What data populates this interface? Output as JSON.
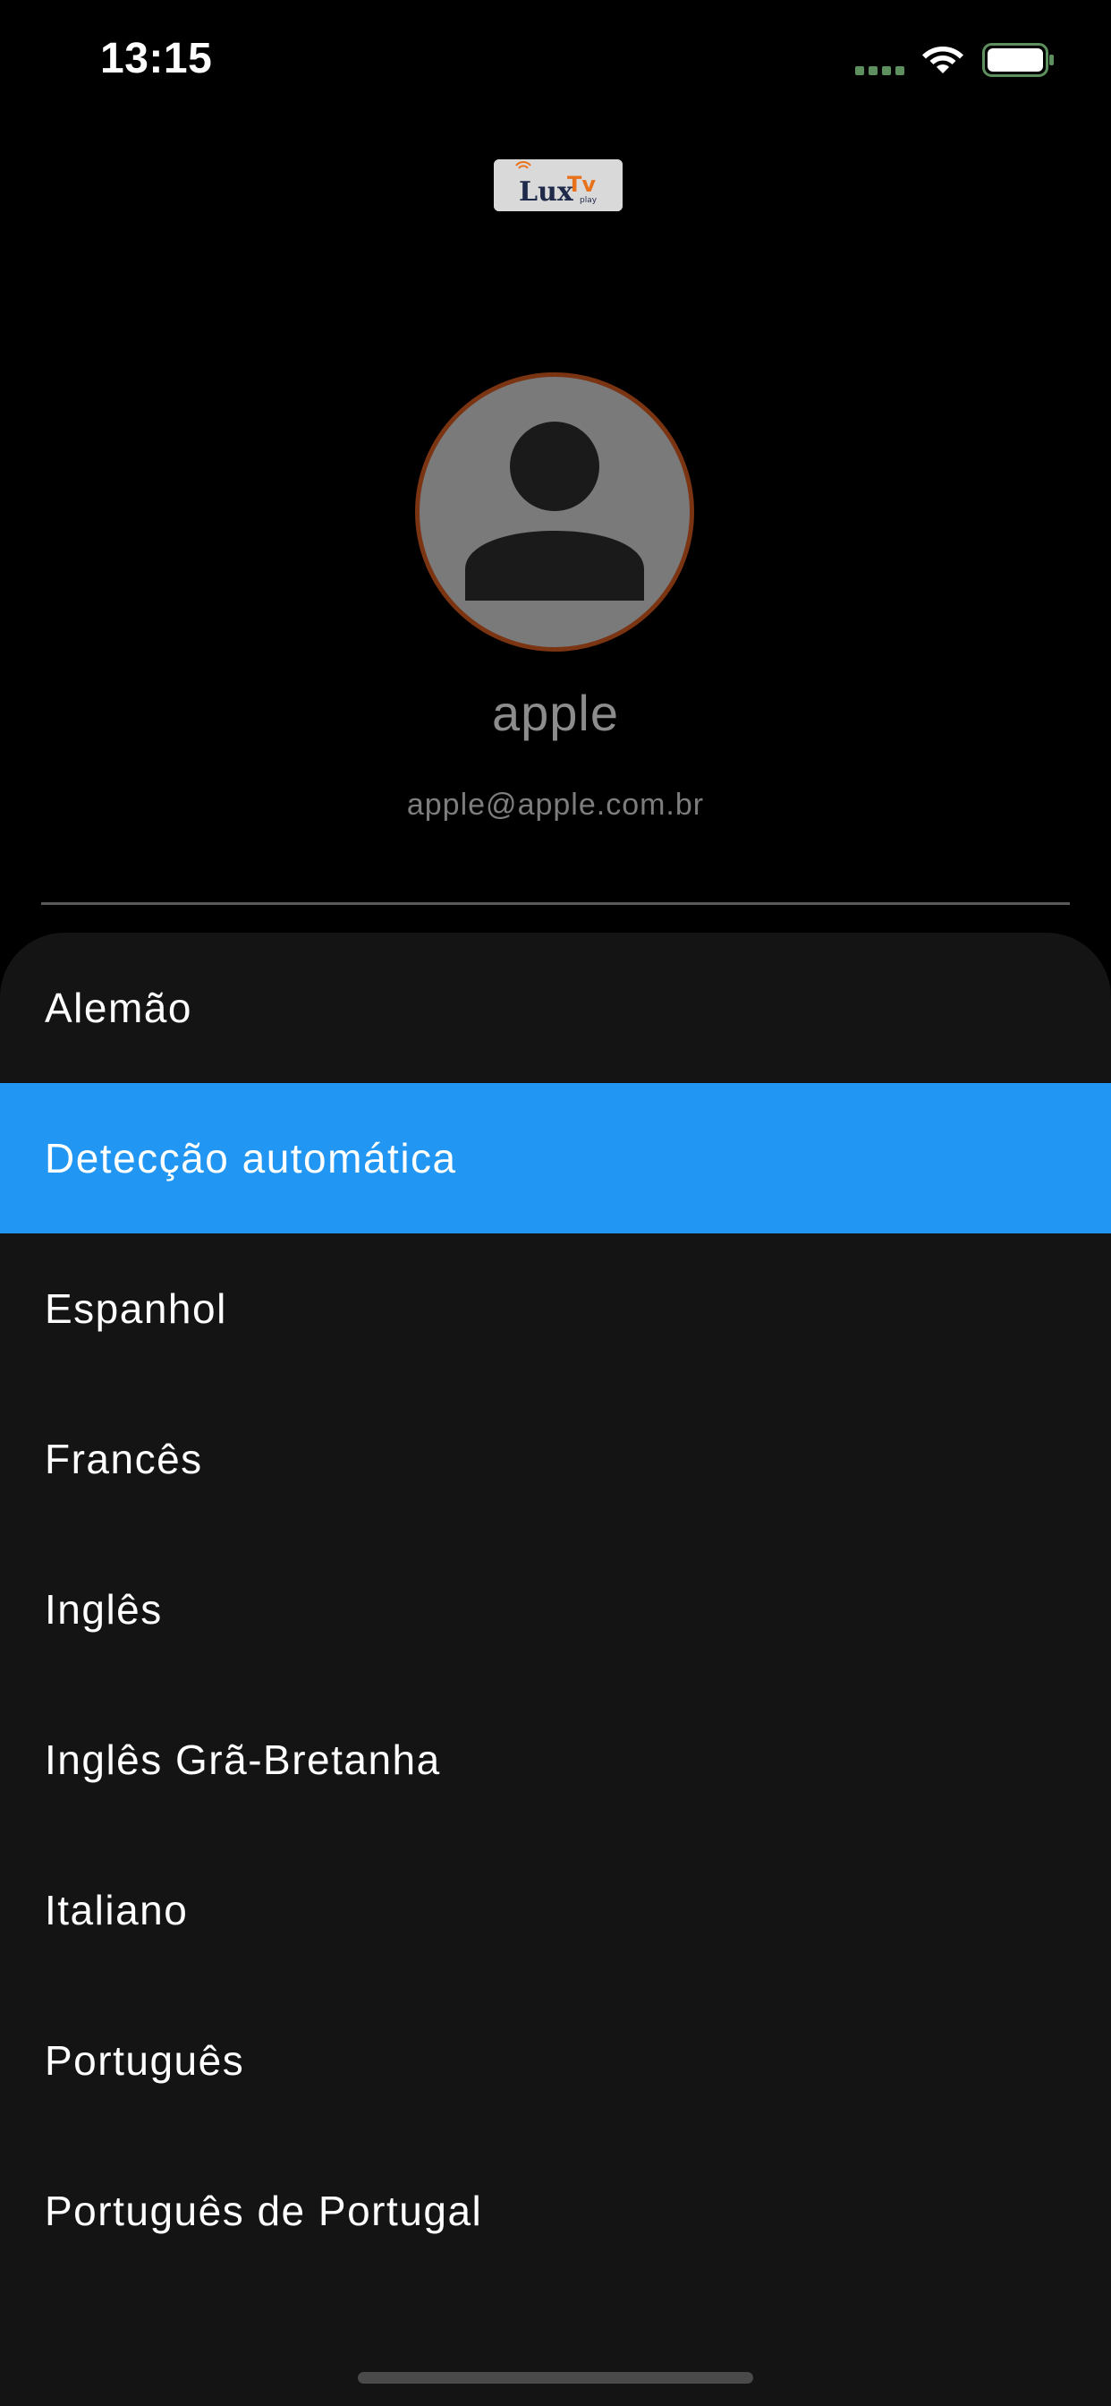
{
  "status_bar": {
    "time": "13:15",
    "signal_icon": "cellular-signal-icon",
    "wifi_icon": "wifi-icon",
    "battery_icon": "battery-full-icon"
  },
  "logo": {
    "text_lux": "Lux",
    "text_tv": "Tv",
    "text_play": "play"
  },
  "profile": {
    "avatar_icon": "person-icon",
    "name": "apple",
    "email": "apple@apple.com.br"
  },
  "languages": {
    "items": [
      {
        "label": "Alemão",
        "selected": false
      },
      {
        "label": "Detecção automática",
        "selected": true
      },
      {
        "label": "Espanhol",
        "selected": false
      },
      {
        "label": "Francês",
        "selected": false
      },
      {
        "label": "Inglês",
        "selected": false
      },
      {
        "label": "Inglês Grã-Bretanha",
        "selected": false
      },
      {
        "label": "Italiano",
        "selected": false
      },
      {
        "label": "Português",
        "selected": false
      },
      {
        "label": "Português de Portugal",
        "selected": false
      }
    ]
  },
  "colors": {
    "background": "#000000",
    "sheet": "#141414",
    "selected": "#2196f3",
    "avatar_border": "#7b3412",
    "signal": "#5e8f5e"
  }
}
